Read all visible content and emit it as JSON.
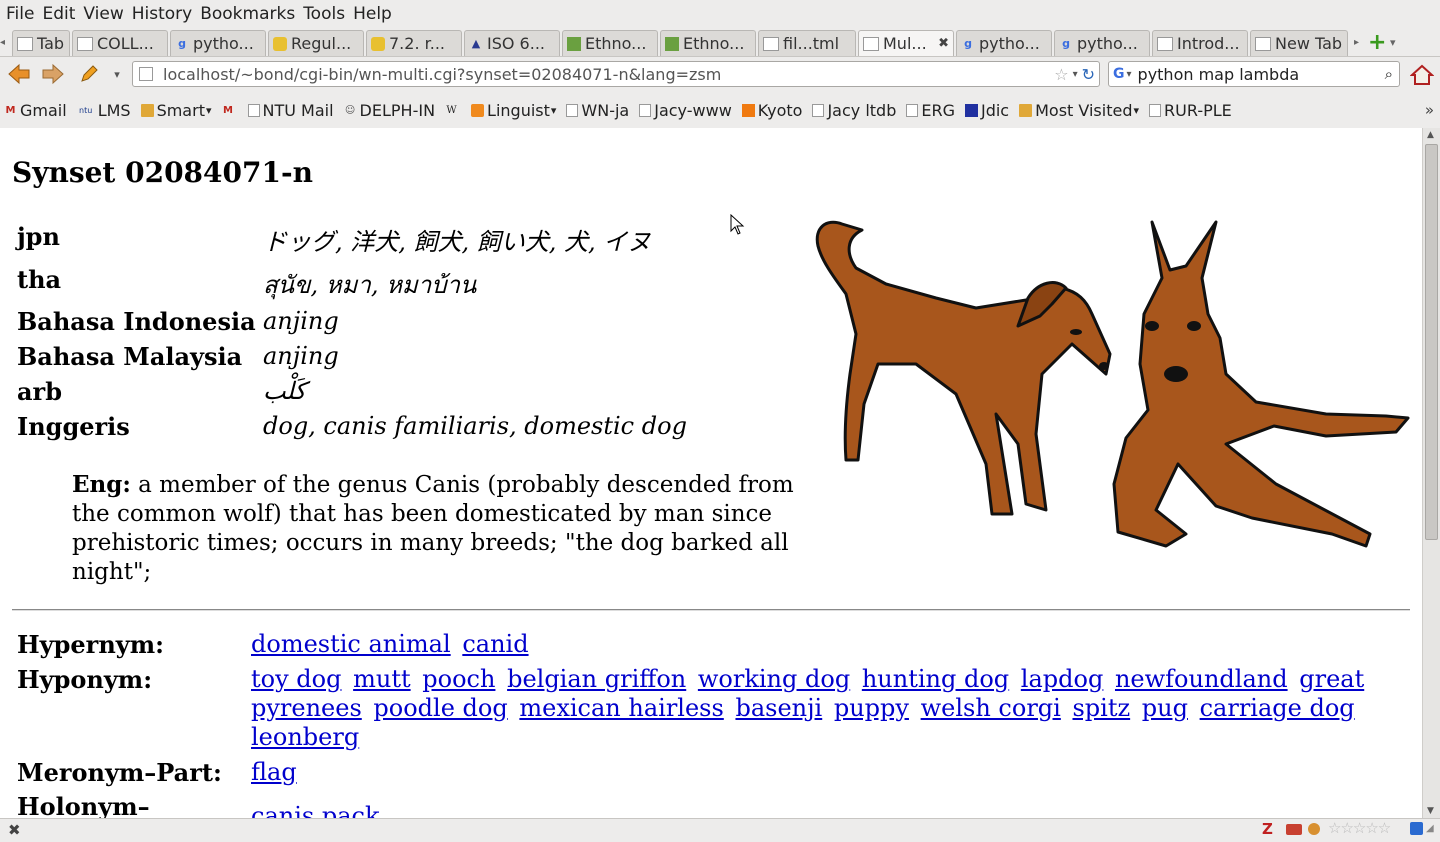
{
  "menu": [
    "File",
    "Edit",
    "View",
    "History",
    "Bookmarks",
    "Tools",
    "Help"
  ],
  "tabs": [
    {
      "label": "Tab",
      "icon": "tab-icon"
    },
    {
      "label": "COLL...",
      "icon": "page-icon"
    },
    {
      "label": "pytho...",
      "icon": "google-icon"
    },
    {
      "label": "Regul...",
      "icon": "python-icon"
    },
    {
      "label": "7.2. r...",
      "icon": "python-icon"
    },
    {
      "label": "ISO 6...",
      "icon": "sil-icon"
    },
    {
      "label": "Ethno...",
      "icon": "cgi-icon"
    },
    {
      "label": "Ethno...",
      "icon": "cgi-icon"
    },
    {
      "label": "fil...tml",
      "icon": "page-icon"
    },
    {
      "label": "Mul...",
      "icon": "page-icon",
      "active": true
    },
    {
      "label": "pytho...",
      "icon": "google-icon"
    },
    {
      "label": "pytho...",
      "icon": "google-icon"
    },
    {
      "label": "Introd...",
      "icon": "page-icon"
    },
    {
      "label": "New Tab",
      "icon": "page-icon"
    }
  ],
  "url": "localhost/~bond/cgi-bin/wn-multi.cgi?synset=02084071-n&lang=zsm",
  "search": "python map lambda",
  "bookmarks": [
    {
      "label": "Gmail",
      "icon": "gmail-icon"
    },
    {
      "label": "LMS",
      "icon": "ntu-icon"
    },
    {
      "label": "Smart",
      "icon": "folder-icon",
      "dropdown": true
    },
    {
      "label": "",
      "icon": "gmail-icon"
    },
    {
      "label": "NTU Mail",
      "icon": "page-icon"
    },
    {
      "label": "DELPH-IN",
      "icon": "delphin-icon"
    },
    {
      "label": "",
      "icon": "wikipedia-icon"
    },
    {
      "label": "Linguist",
      "icon": "rss-icon",
      "dropdown": true
    },
    {
      "label": "WN-ja",
      "icon": "page-icon"
    },
    {
      "label": "Jacy-www",
      "icon": "page-icon"
    },
    {
      "label": "Kyoto",
      "icon": "kyoto-icon"
    },
    {
      "label": "Jacy ltdb",
      "icon": "page-icon"
    },
    {
      "label": "ERG",
      "icon": "page-icon"
    },
    {
      "label": "Jdic",
      "icon": "jdic-icon"
    },
    {
      "label": "Most Visited",
      "icon": "most-visited-icon",
      "dropdown": true
    },
    {
      "label": "RUR-PLE",
      "icon": "page-icon"
    }
  ],
  "page": {
    "title": "Synset 02084071-n",
    "languages": [
      {
        "lang": "jpn",
        "words": "ドッグ, 洋犬, 飼犬, 飼い犬, 犬, イヌ"
      },
      {
        "lang": "tha",
        "words": "สุนัข, หมา, หมาบ้าน"
      },
      {
        "lang": "Bahasa Indonesia",
        "words": "anjing"
      },
      {
        "lang": "Bahasa Malaysia",
        "words": "anjing"
      },
      {
        "lang": "arb",
        "words": "كَلْب"
      },
      {
        "lang": "Inggeris",
        "words": "dog, canis familiaris, domestic dog"
      }
    ],
    "gloss_label": "Eng:",
    "gloss_text": " a member of the genus Canis (probably descended from the common wolf) that has been domesticated by man since prehistoric times; occurs in many breeds; \"the dog barked all night\";",
    "relations": [
      {
        "label": "Hypernym:",
        "links": [
          "domestic animal",
          "canid"
        ]
      },
      {
        "label": "Hyponym:",
        "links": [
          "toy dog",
          "mutt",
          "pooch",
          "belgian griffon",
          "working dog",
          "hunting dog",
          "lapdog",
          "newfoundland",
          "great pyrenees",
          "poodle dog",
          "mexican hairless",
          "basenji",
          "puppy",
          "welsh corgi",
          "spitz",
          "pug",
          "carriage dog",
          "leonberg"
        ]
      },
      {
        "label": "Meronym–Part:",
        "links": [
          "flag"
        ]
      },
      {
        "label": "Holonym–",
        "links": [
          "canis pack"
        ]
      }
    ]
  },
  "colors": {
    "link": "#0000cc",
    "dog_fill": "#a8561c",
    "chrome": "#edeceb"
  }
}
